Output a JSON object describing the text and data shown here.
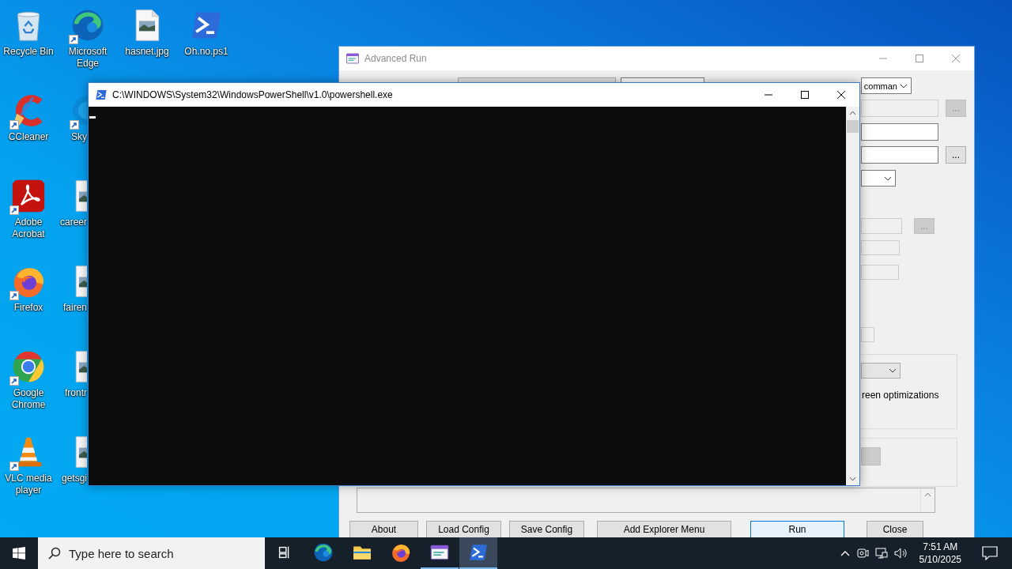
{
  "desktop": {
    "columns": [
      [
        {
          "label": "Recycle Bin",
          "kind": "recycle",
          "shortcut": false,
          "clipped": false
        },
        {
          "label": "CCleaner",
          "kind": "ccleaner",
          "shortcut": true,
          "clipped": false
        },
        {
          "label": "Adobe Acrobat",
          "kind": "acrobat",
          "shortcut": true,
          "clipped": false
        },
        {
          "label": "Firefox",
          "kind": "firefox",
          "shortcut": true,
          "clipped": false
        },
        {
          "label": "Google Chrome",
          "kind": "chrome",
          "shortcut": true,
          "clipped": false
        },
        {
          "label": "VLC media player",
          "kind": "vlc",
          "shortcut": true,
          "clipped": false
        }
      ],
      [
        {
          "label": "Microsoft Edge",
          "kind": "edge",
          "shortcut": true,
          "clipped": false
        },
        {
          "label": "Sky",
          "kind": "skype",
          "shortcut": true,
          "clipped": true
        },
        {
          "label": "career",
          "kind": "image",
          "shortcut": false,
          "clipped": true
        },
        {
          "label": "fairen",
          "kind": "image",
          "shortcut": false,
          "clipped": true
        },
        {
          "label": "frontr",
          "kind": "image",
          "shortcut": false,
          "clipped": true
        },
        {
          "label": "getsgi",
          "kind": "image",
          "shortcut": false,
          "clipped": true
        }
      ],
      [
        {
          "label": "hasnet.jpg",
          "kind": "image",
          "shortcut": false,
          "clipped": false
        }
      ],
      [
        {
          "label": "Oh.no.ps1",
          "kind": "powershell",
          "shortcut": false,
          "clipped": false
        }
      ]
    ]
  },
  "advanced_run": {
    "title": "Advanced Run",
    "active": false,
    "rows": [
      {
        "items": [
          {
            "kind": "button"
          },
          {
            "kind": "field",
            "disabled": false
          },
          {
            "kind": "dropdown",
            "text": "comman",
            "disabled": false
          }
        ]
      },
      {
        "items": [
          {
            "kind": "field",
            "disabled": true
          },
          {
            "kind": "browse",
            "label": "...",
            "disabled": true
          }
        ]
      },
      {
        "items": [
          {
            "kind": "field",
            "disabled": false
          }
        ]
      },
      {
        "items": [
          {
            "kind": "field",
            "disabled": false
          },
          {
            "kind": "browse",
            "label": "...",
            "disabled": false
          }
        ]
      },
      {
        "items": [
          {
            "kind": "dropdown",
            "disabled": false
          }
        ]
      },
      {
        "items": [
          {
            "kind": "field",
            "disabled": true
          },
          {
            "kind": "browse",
            "label": "...",
            "disabled": true
          }
        ]
      },
      {
        "items": [
          {
            "kind": "field",
            "disabled": true
          }
        ]
      },
      {
        "items": [
          {
            "kind": "field",
            "disabled": true
          }
        ]
      },
      {
        "items": [
          {
            "kind": "field",
            "disabled": true
          }
        ]
      }
    ],
    "options_group": {
      "dropdown": {
        "disabled": true
      },
      "checkbox_label": "reen optimizations"
    },
    "output_group": {
      "button": {
        "disabled": true
      }
    },
    "buttons": [
      {
        "label": "About",
        "default": false
      },
      {
        "label": "Load Config",
        "default": false
      },
      {
        "label": "Save Config",
        "default": false
      },
      {
        "label": "Add Explorer Menu",
        "default": false
      },
      {
        "label": "Run",
        "default": true
      },
      {
        "label": "Close",
        "default": false
      }
    ]
  },
  "powershell": {
    "title": "C:\\WINDOWS\\System32\\WindowsPowerShell\\v1.0\\powershell.exe",
    "active": true
  },
  "taskbar": {
    "search": {
      "placeholder": "Type here to search"
    },
    "apps": [
      {
        "kind": "taskview",
        "running": false,
        "selected": false
      },
      {
        "kind": "edge",
        "running": false,
        "selected": false
      },
      {
        "kind": "explorer",
        "running": false,
        "selected": false
      },
      {
        "kind": "firefox",
        "running": false,
        "selected": false
      },
      {
        "kind": "advancedrun",
        "running": true,
        "selected": false
      },
      {
        "kind": "powershell",
        "running": true,
        "selected": true
      }
    ],
    "clock": {
      "time": "7:51 AM",
      "date": "5/10/2025"
    }
  }
}
